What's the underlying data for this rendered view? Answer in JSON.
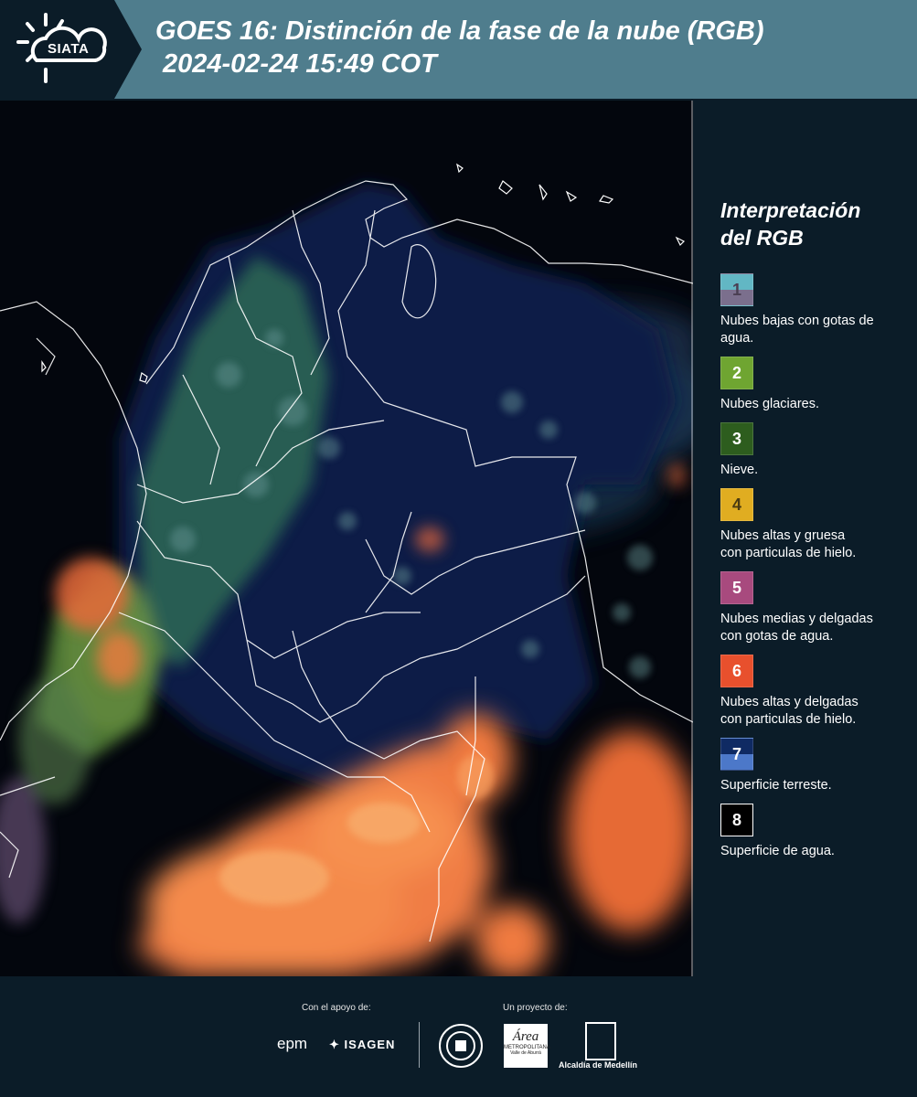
{
  "header": {
    "logo_text": "SIATA",
    "title_line1": "GOES 16: Distinción de la fase de la nube (RGB)",
    "title_line2": "2024-02-24 15:49 COT"
  },
  "legend": {
    "title_line1": "Interpretación",
    "title_line2": "del RGB",
    "items": [
      {
        "num": "1",
        "text_line1": "Nubes bajas con gotas de",
        "text_line2": "agua.",
        "color_top": "#62b7c4",
        "color_bottom": "#7b6f8d",
        "num_color": "#4a3e52"
      },
      {
        "num": "2",
        "text_line1": "Nubes glaciares.",
        "text_line2": "",
        "color_top": "#6fa531",
        "color_bottom": "#6fa531",
        "num_color": "#ffffff"
      },
      {
        "num": "3",
        "text_line1": "Nieve.",
        "text_line2": "",
        "color_top": "#2d5d1e",
        "color_bottom": "#2d5d1e",
        "num_color": "#ffffff"
      },
      {
        "num": "4",
        "text_line1": "Nubes altas y gruesa",
        "text_line2": "con particulas de hielo.",
        "color_top": "#e0ad21",
        "color_bottom": "#e0ad21",
        "num_color": "#4a3b12"
      },
      {
        "num": "5",
        "text_line1": "Nubes medias y delgadas",
        "text_line2": "con gotas de agua.",
        "color_top": "#a84a7e",
        "color_bottom": "#a84a7e",
        "num_color": "#ffffff"
      },
      {
        "num": "6",
        "text_line1": "Nubes altas y delgadas",
        "text_line2": "con particulas de hielo.",
        "color_top": "#e8502d",
        "color_bottom": "#e8502d",
        "num_color": "#ffffff"
      },
      {
        "num": "7",
        "text_line1": "Superficie terreste.",
        "text_line2": "",
        "color_top": "#0f2a63",
        "color_bottom": "#4c78c9",
        "num_color": "#ffffff"
      },
      {
        "num": "8",
        "text_line1": "Superficie de agua.",
        "text_line2": "",
        "color_top": "#000000",
        "color_bottom": "#000000",
        "num_color": "#ffffff"
      }
    ]
  },
  "footer": {
    "support_label": "Con el apoyo de:",
    "project_label": "Un proyecto de:",
    "brand_epm": "epm",
    "brand_isagen": "ISAGEN",
    "brand_area_metro": "Área",
    "brand_area_sub1": "METROPOLITANA",
    "brand_area_sub2": "Valle de Aburrá",
    "brand_medellin": "Alcaldía de Medellín"
  }
}
